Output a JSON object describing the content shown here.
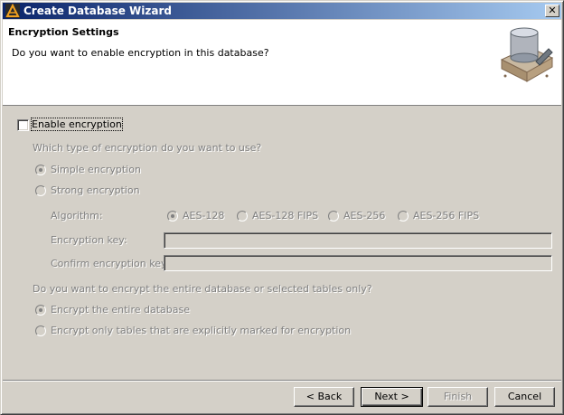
{
  "window": {
    "title": "Create Database Wizard",
    "close_glyph": "✕"
  },
  "header": {
    "title": "Encryption Settings",
    "subtitle": "Do you want to enable encryption in this database?"
  },
  "enable": {
    "label": "Enable encryption",
    "checked": false
  },
  "type_section": {
    "question": "Which type of encryption do you want to use?",
    "simple": "Simple encryption",
    "strong": "Strong encryption",
    "selected": "simple"
  },
  "algorithm": {
    "label": "Algorithm:",
    "options": [
      "AES-128",
      "AES-128 FIPS",
      "AES-256",
      "AES-256 FIPS"
    ],
    "selected": "AES-128"
  },
  "key": {
    "label": "Encryption key:",
    "value": ""
  },
  "confirm_key": {
    "label": "Confirm encryption key:",
    "value": ""
  },
  "scope_section": {
    "question": "Do you want to encrypt the entire database or selected tables only?",
    "entire": "Encrypt the entire database",
    "marked": "Encrypt only tables that are explicitly marked for encryption",
    "selected": "entire"
  },
  "buttons": {
    "back": "< Back",
    "next": "Next >",
    "finish": "Finish",
    "cancel": "Cancel"
  }
}
